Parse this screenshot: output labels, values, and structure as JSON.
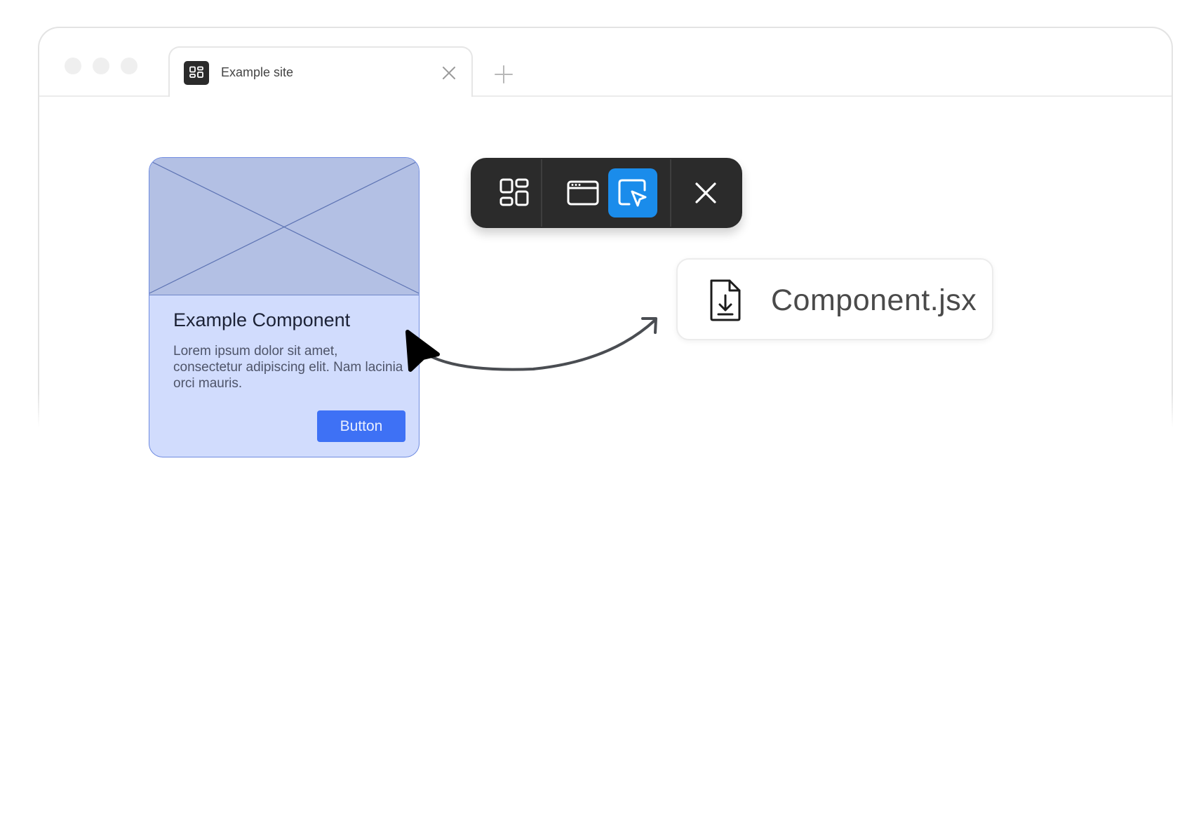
{
  "browser": {
    "tab": {
      "title": "Example site",
      "favicon": "grid-icon"
    },
    "new_tab_icon": "plus-icon",
    "close_tab_icon": "close-icon"
  },
  "component_card": {
    "title": "Example Component",
    "body": "Lorem ipsum dolor sit amet, consectetur adipiscing elit. Nam lacinia orci mauris.",
    "button_label": "Button"
  },
  "toolbar": {
    "items": [
      {
        "icon": "grid-icon"
      },
      {
        "icon": "browser-window-icon"
      },
      {
        "icon": "select-element-icon",
        "active": true
      },
      {
        "icon": "close-icon"
      }
    ],
    "active_color": "#1a8ceb"
  },
  "export_file": {
    "name": "Component.jsx",
    "icon": "file-download-icon"
  },
  "colors": {
    "card_fill": "#d1dcfd",
    "card_media": "#b3c0e4",
    "button": "#3e71f5",
    "toolbar_bg": "#2b2b2b"
  }
}
